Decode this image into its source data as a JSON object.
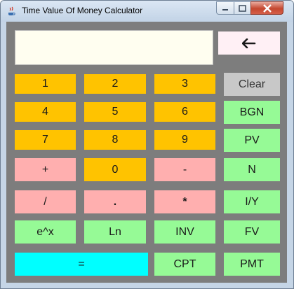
{
  "window": {
    "title": "Time Value Of Money Calculator"
  },
  "display": {
    "value": ""
  },
  "keys": {
    "backspace": "🡐",
    "k1": "1",
    "k2": "2",
    "k3": "3",
    "clear": "Clear",
    "k4": "4",
    "k5": "5",
    "k6": "6",
    "bgn": "BGN",
    "k7": "7",
    "k8": "8",
    "k9": "9",
    "pv": "PV",
    "plus": "+",
    "k0": "0",
    "minus": "-",
    "n": "N",
    "divide": "/",
    "dot": ".",
    "multiply": "*",
    "iy": "I/Y",
    "exp": "e^x",
    "ln": "Ln",
    "inv": "INV",
    "fv": "FV",
    "equals": "=",
    "cpt": "CPT",
    "pmt": "PMT"
  },
  "colors": {
    "digit": "#ffc300",
    "operator": "#ffafaf",
    "function": "#96fa96",
    "clear": "#c8c8c8",
    "equals": "#00ffff",
    "panel": "#7d7d7d",
    "display": "#fffef0"
  }
}
